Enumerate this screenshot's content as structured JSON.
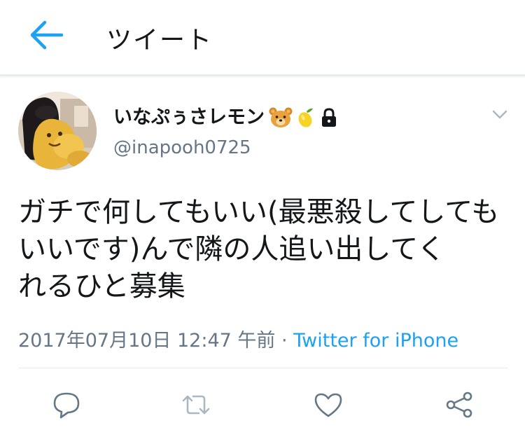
{
  "header": {
    "title": "ツイート",
    "back_icon": "back-arrow-icon"
  },
  "tweet": {
    "display_name": "いなぷぅさレモン",
    "name_emojis": [
      "bear-face-icon",
      "lemon-icon",
      "lock-icon"
    ],
    "handle": "@inapooh0725",
    "text_lines": [
      "ガチで何してもいい(最悪殺してしても",
      "いいです)んで隣の人追い出してく",
      "れるひと募集"
    ],
    "timestamp": "2017年07月10日 12:47 午前",
    "separator": " · ",
    "source": "Twitter for iPhone"
  },
  "actions": [
    "reply-icon",
    "retweet-icon",
    "like-icon",
    "share-icon"
  ],
  "colors": {
    "accent": "#1da1f2",
    "secondary_text": "#657786",
    "divider": "#e6ecf0"
  }
}
